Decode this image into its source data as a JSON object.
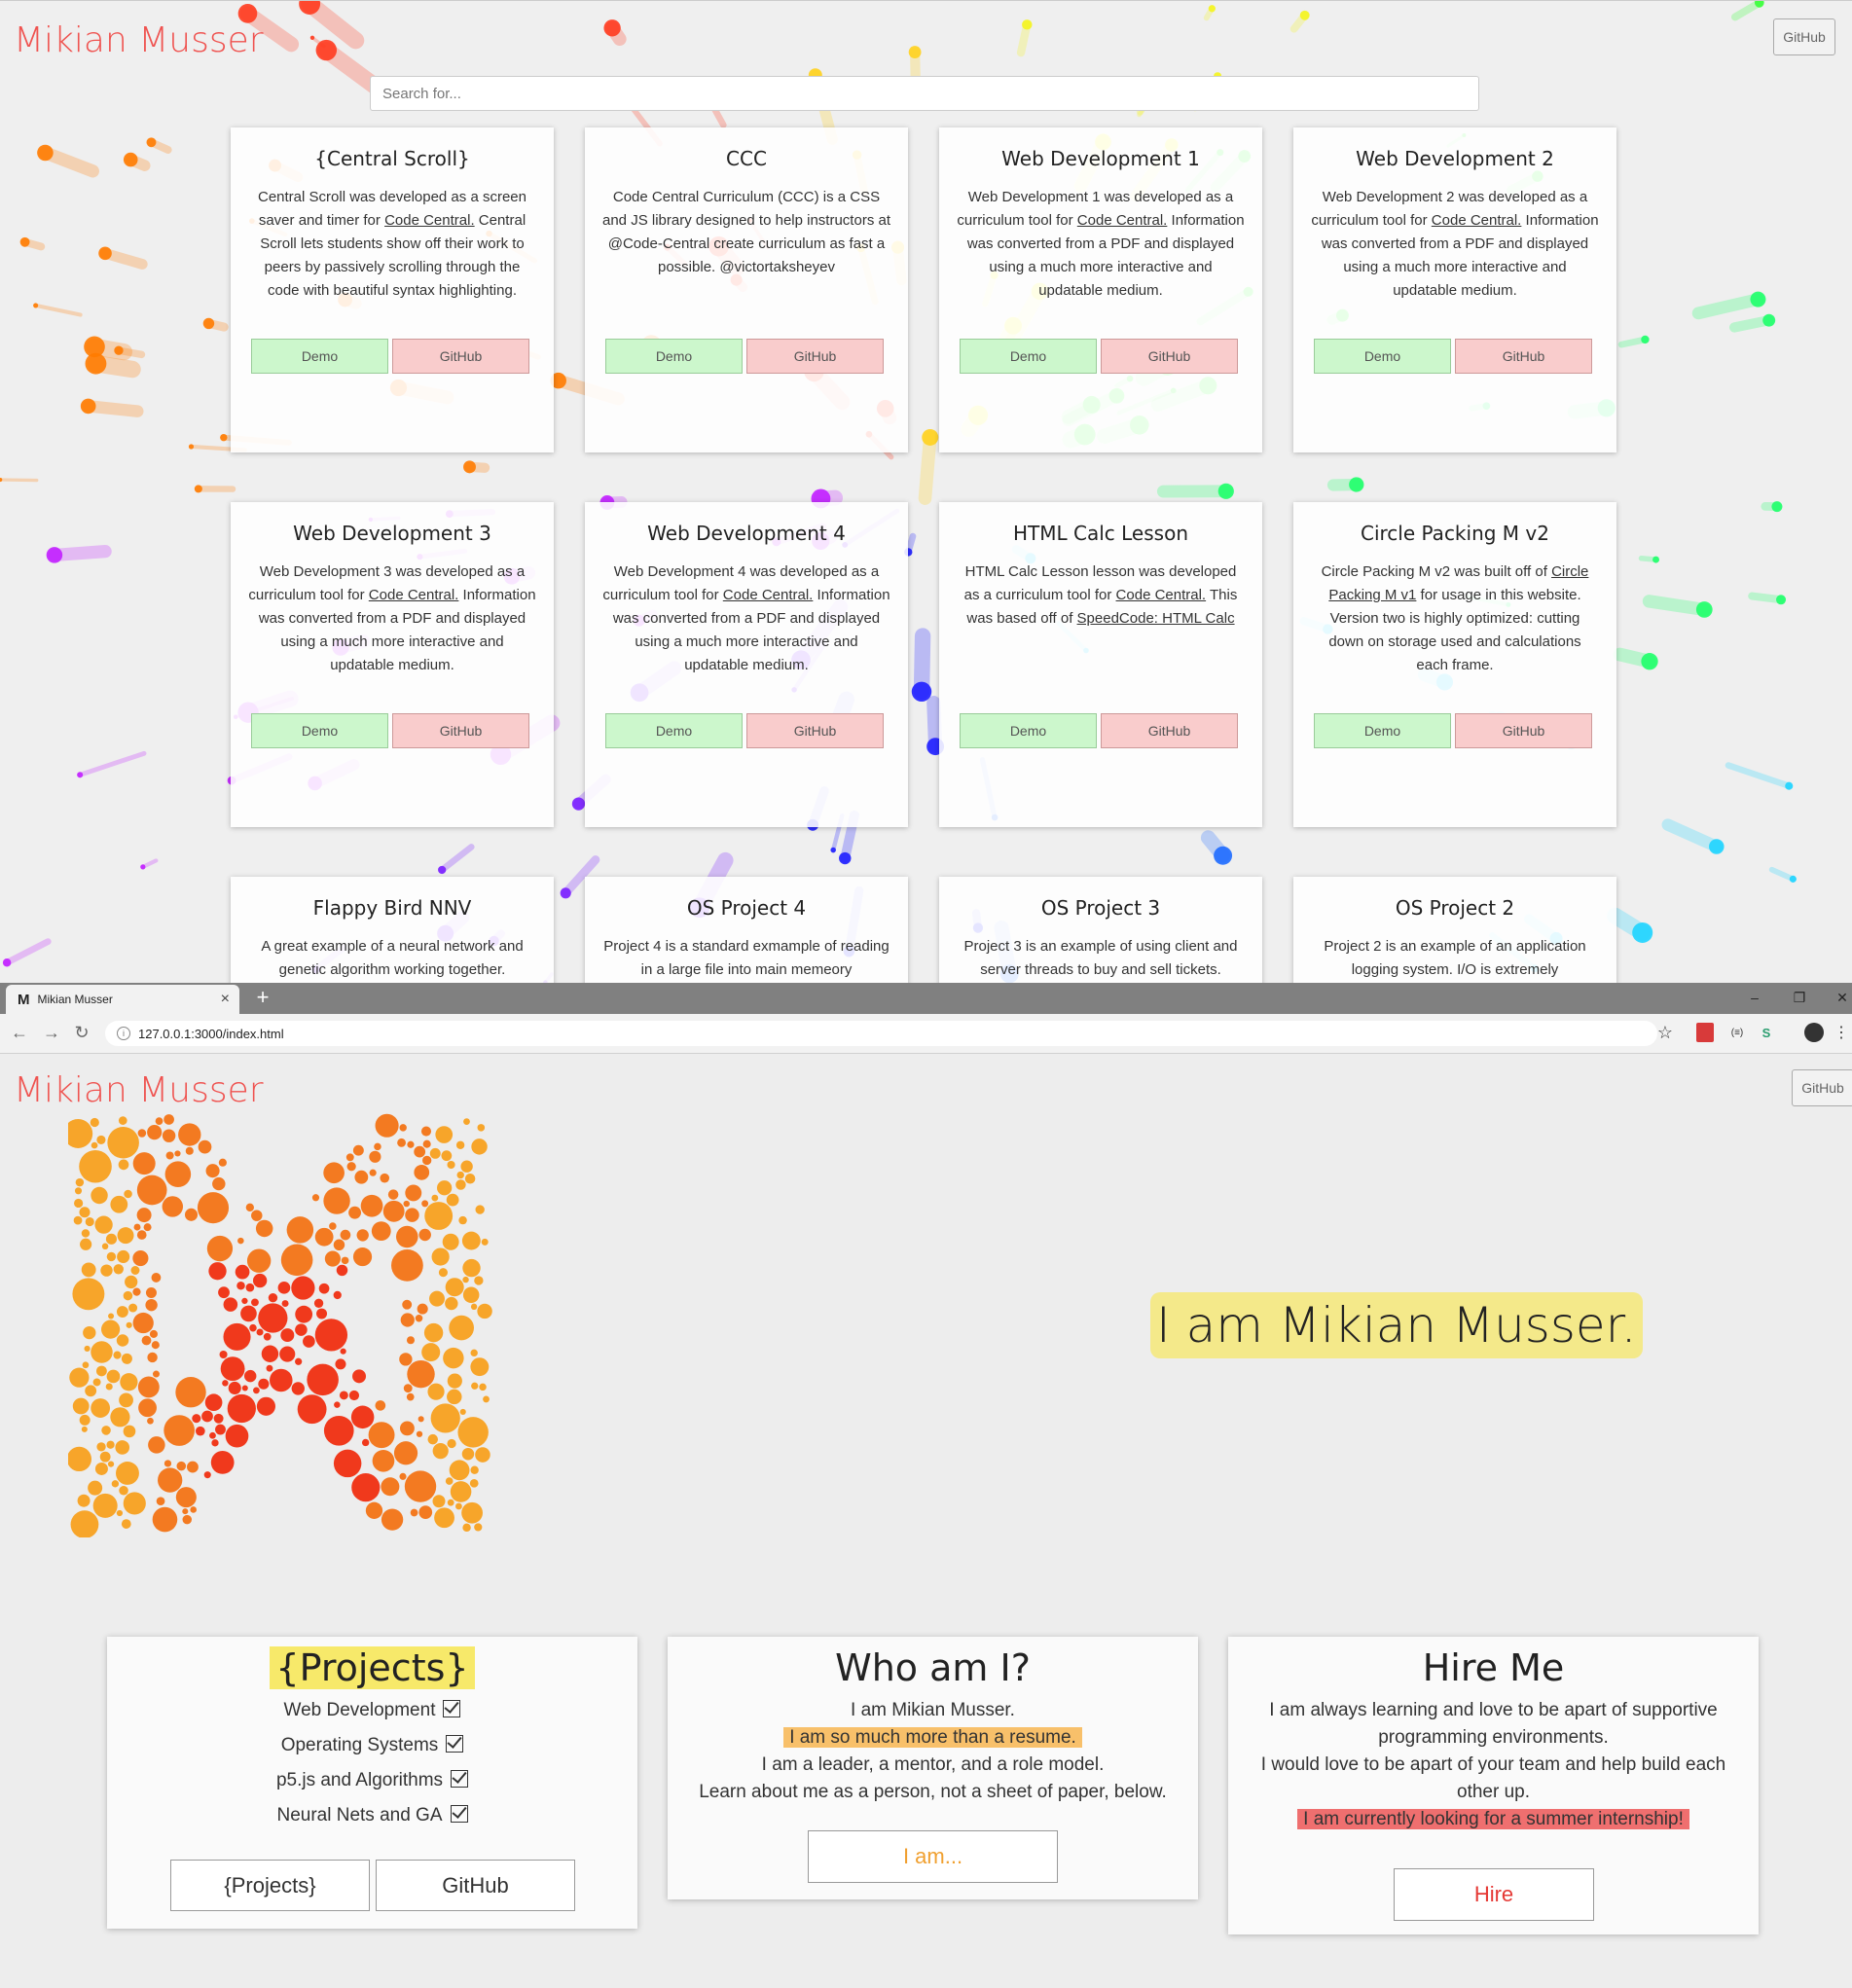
{
  "site": {
    "brand": "Mikian Musser",
    "github_label": "GitHub"
  },
  "search": {
    "placeholder": "Search for..."
  },
  "projects": [
    {
      "title": "{Central Scroll}",
      "pre": "Central Scroll was developed as a screen saver and timer for ",
      "link1": "Code Central.",
      "mid": " Central Scroll lets students show off their work to peers by passively scrolling through the code with beautiful syntax highlighting.",
      "link2": "",
      "post": "",
      "demo": "Demo",
      "github": "GitHub"
    },
    {
      "title": "CCC",
      "pre": "Code Central Curriculum (CCC) is a CSS and JS library designed to help instructors at @Code-Central create curriculum as fast a possible. @victortaksheyev",
      "link1": "",
      "mid": "",
      "link2": "",
      "post": "",
      "demo": "Demo",
      "github": "GitHub"
    },
    {
      "title": "Web Development 1",
      "pre": "Web Development 1 was developed as a curriculum tool for ",
      "link1": "Code Central.",
      "mid": " Information was converted from a PDF and displayed using a much more interactive and updatable medium.",
      "link2": "",
      "post": "",
      "demo": "Demo",
      "github": "GitHub"
    },
    {
      "title": "Web Development 2",
      "pre": "Web Development 2 was developed as a curriculum tool for ",
      "link1": "Code Central.",
      "mid": " Information was converted from a PDF and displayed using a much more interactive and updatable medium.",
      "link2": "",
      "post": "",
      "demo": "Demo",
      "github": "GitHub"
    },
    {
      "title": "Web Development 3",
      "pre": "Web Development 3 was developed as a curriculum tool for ",
      "link1": "Code Central.",
      "mid": " Information was converted from a PDF and displayed using a much more interactive and updatable medium.",
      "link2": "",
      "post": "",
      "demo": "Demo",
      "github": "GitHub"
    },
    {
      "title": "Web Development 4",
      "pre": "Web Development 4 was developed as a curriculum tool for ",
      "link1": "Code Central.",
      "mid": " Information was converted from a PDF and displayed using a much more interactive and updatable medium.",
      "link2": "",
      "post": "",
      "demo": "Demo",
      "github": "GitHub"
    },
    {
      "title": "HTML Calc Lesson",
      "pre": "HTML Calc Lesson lesson was developed as a curriculum tool for ",
      "link1": "Code Central.",
      "mid": " This was based off of ",
      "link2": "SpeedCode: HTML Calc",
      "post": "",
      "demo": "Demo",
      "github": "GitHub"
    },
    {
      "title": "Circle Packing M v2",
      "pre": "Circle Packing M v2 was built off of ",
      "link1": "Circle Packing M v1",
      "mid": " for usage in this website. Version two is highly optimized: cutting down on storage used and calculations each frame.",
      "link2": "",
      "post": "",
      "demo": "Demo",
      "github": "GitHub"
    },
    {
      "title": "Flappy Bird NNV",
      "pre": "A great example of a neural network and genetic algorithm working together.",
      "link1": "",
      "mid": "",
      "link2": "",
      "post": "",
      "demo": "",
      "github": ""
    },
    {
      "title": "OS Project 4",
      "pre": "Project 4 is a standard exmample of reading in a large file into main memeory",
      "link1": "",
      "mid": "",
      "link2": "",
      "post": "",
      "demo": "",
      "github": ""
    },
    {
      "title": "OS Project 3",
      "pre": "Project 3 is an example of using client and server threads to buy and sell tickets.",
      "link1": "",
      "mid": "",
      "link2": "",
      "post": "",
      "demo": "",
      "github": ""
    },
    {
      "title": "OS Project 2",
      "pre": "Project 2 is an example of an application logging system. I/O is extremely",
      "link1": "",
      "mid": "",
      "link2": "",
      "post": "",
      "demo": "",
      "github": ""
    }
  ],
  "browser": {
    "tab_title": "Mikian Musser",
    "tab_favicon": "M",
    "url": "127.0.0.1:3000/index.html",
    "new_tab": "+",
    "minimize": "–",
    "restore": "❐",
    "close": "✕",
    "tab_close": "×",
    "back": "←",
    "forward": "→",
    "reload": "↻",
    "star": "☆",
    "menu": "⋮",
    "ext_s": "S",
    "ext_mid": "(≡)"
  },
  "hero": {
    "text": "I am Mikian Musser."
  },
  "cards": {
    "projects": {
      "title": "{Projects}",
      "items": [
        "Web Development",
        "Operating Systems",
        "p5.js and Algorithms",
        "Neural Nets and GA"
      ],
      "btn1": "{Projects}",
      "btn2": "GitHub"
    },
    "who": {
      "title": "Who am I?",
      "line1": "I am Mikian Musser.",
      "line2": "I am so much more than a resume.",
      "line3": "I am a leader, a mentor, and a role model.",
      "line4": "Learn about me as a person, not a sheet of paper, below.",
      "btn": "I am..."
    },
    "hire": {
      "title": "Hire Me",
      "line1": "I am always learning and love to be apart of supportive programming environments.",
      "line2": "I would love to be apart of your team and help build each other up.",
      "line3": "I am currently looking for a summer internship!",
      "btn": "Hire"
    }
  },
  "colors": {
    "brand": "#ef5350",
    "demo": "#ccf7cc",
    "github": "#f9cccc",
    "hero_bg": "#f4e98a"
  }
}
